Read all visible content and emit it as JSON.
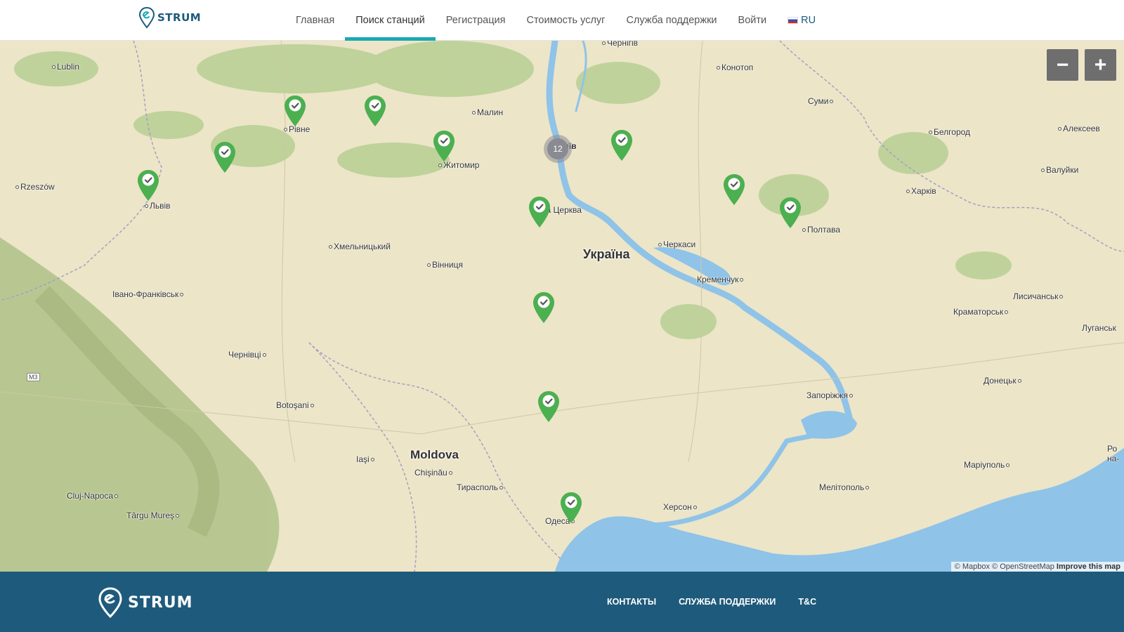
{
  "brand": {
    "name": "STRUM"
  },
  "nav": {
    "items": [
      {
        "label": "Главная"
      },
      {
        "label": "Поиск станций"
      },
      {
        "label": "Регистрация"
      },
      {
        "label": "Стоимость услуг"
      },
      {
        "label": "Служба поддержки"
      },
      {
        "label": "Войти"
      }
    ],
    "active": "Поиск станций",
    "language": "RU"
  },
  "map": {
    "country_labels": [
      "Україна",
      "Moldova"
    ],
    "cities": [
      "Lublin",
      "Rzeszów",
      "Рівне",
      "Львів",
      "Житомир",
      "Малин",
      "Київ",
      "Чернігів",
      "Конотоп",
      "Суми",
      "Белгород",
      "Алексеев",
      "Валуйки",
      "Харків",
      "Полтава",
      "Біла Церква",
      "Хмельницький",
      "Вінниця",
      "Черкаси",
      "Кременчук",
      "Івано-Франківськ",
      "Лисичанськ",
      "Краматорськ",
      "Луганськ",
      "Чернівці",
      "Донецьк",
      "Запоріжжя",
      "Botoşani",
      "Iaşi",
      "Chişinău",
      "Тирасполь",
      "Cluj-Napoca",
      "Târgu Mureş",
      "Маріуполь",
      "Мелітополь",
      "Херсон",
      "Одеса",
      "Ро на-"
    ],
    "road_shield": "M3",
    "cluster_count": "12",
    "zoom_out_label": "−",
    "zoom_in_label": "+",
    "attribution": {
      "mapbox": "© Mapbox",
      "osm": "© OpenStreetMap",
      "improve": "Improve this map"
    },
    "colors": {
      "marker": "#4caf50",
      "water": "#8fc3e8",
      "land": "#ece5c8",
      "forest": "#b7cf93"
    }
  },
  "footer": {
    "brand": "STRUM",
    "links": [
      "КОНТАКТЫ",
      "СЛУЖБА ПОДДЕРЖКИ",
      "T&C"
    ]
  }
}
